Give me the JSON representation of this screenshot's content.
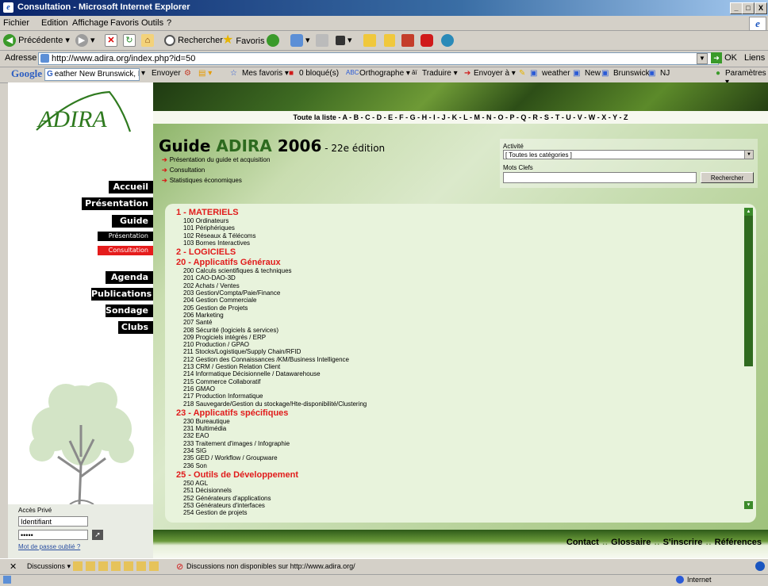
{
  "window": {
    "title": "Consultation - Microsoft Internet Explorer",
    "controls": {
      "minimize": "_",
      "maximize": "□",
      "close": "X"
    }
  },
  "menu": [
    "Fichier",
    "Edition",
    "Affichage",
    "Favoris",
    "Outils",
    "?"
  ],
  "toolbar": {
    "back": "Précédente",
    "search": "Rechercher",
    "favorites": "Favoris"
  },
  "address": {
    "label": "Adresse",
    "url": "http://www.adira.org/index.php?id=50",
    "go": "OK",
    "links": "Liens"
  },
  "google_bar": {
    "logo": "Google",
    "search_value": "eather New Brunswick, NJ",
    "items": [
      "Envoyer",
      "Mes favoris ▾",
      "0 bloqué(s)",
      "Orthographe ▾",
      "Traduire ▾",
      "Envoyer à ▾",
      "weather",
      "New",
      "Brunswick",
      "NJ"
    ],
    "settings": "Paramètres ▾"
  },
  "site": {
    "logo_text": "ADIRA",
    "nav": [
      {
        "label": "Accueil",
        "size": "big",
        "active": false
      },
      {
        "label": "Présentation",
        "size": "big",
        "active": false
      },
      {
        "label": "Guide",
        "size": "big",
        "active": false
      },
      {
        "label": "Présentation",
        "size": "small",
        "active": false
      },
      {
        "label": "Consultation",
        "size": "small",
        "active": true
      },
      {
        "label": "Agenda",
        "size": "big",
        "active": false
      },
      {
        "label": "Publications",
        "size": "big",
        "active": false
      },
      {
        "label": "Sondage",
        "size": "big",
        "active": false
      },
      {
        "label": "Clubs",
        "size": "big",
        "active": false
      }
    ],
    "login": {
      "title": "Accès Privé",
      "identifier": "Identifiant",
      "password": "•••••",
      "forgot": "Mot de passe oublié ?"
    },
    "az_bar": "Toute la liste - A - B - C - D - E - F - G - H - I - J - K - L - M - N - O - P - Q - R - S - T - U - V - W - X - Y - Z",
    "guide": {
      "title_prefix": "Guide ",
      "title_green": "ADIRA",
      "title_year": " 2006",
      "edition": " - 22e édition",
      "links": [
        "Présentation du guide et acquisition",
        "Consultation",
        "Statistiques économiques"
      ]
    },
    "search": {
      "activity_label": "Activité",
      "activity_value": "[ Toutes les catégories ]",
      "keywords_label": "Mots Clefs",
      "keywords_value": "",
      "button": "Rechercher"
    },
    "categories": [
      {
        "title": "1 - MATERIELS",
        "items": [
          "100 Ordinateurs",
          "101 Périphériques",
          "102 Réseaux & Télécoms",
          "103 Bornes Interactives"
        ]
      },
      {
        "title": "2 - LOGICIELS",
        "items": []
      },
      {
        "title": "20 - Applicatifs Généraux",
        "items": [
          "200 Calculs scientifiques & techniques",
          "201 CAO-DAO-3D",
          "202 Achats / Ventes",
          "203 Gestion/Compta/Paie/Finance",
          "204 Gestion Commerciale",
          "205 Gestion de Projets",
          "206 Marketing",
          "207 Santé",
          "208 Sécurité (logiciels & services)",
          "209 Progiciels intégrés / ERP",
          "210 Production / GPAO",
          "211 Stocks/Logistique/Supply Chain/RFID",
          "212 Gestion des Connaissances /KM/Business Intelligence",
          "213 CRM / Gestion Relation Client",
          "214 Informatique Décisionnelle / Datawarehouse",
          "215 Commerce Collaboratif",
          "216 GMAO",
          "217 Production Informatique",
          "218 Sauvegarde/Gestion du stockage/Hte-disponibilité/Clustering"
        ]
      },
      {
        "title": "23 - Applicatifs spécifiques",
        "items": [
          "230 Bureautique",
          "231 Multimédia",
          "232 EAO",
          "233 Traitement d'images / Infographie",
          "234 SIG",
          "235 GED / Workflow / Groupware",
          "236 Son"
        ]
      },
      {
        "title": "25 - Outils de Développement",
        "items": [
          "250 AGL",
          "251 Décisionnels",
          "252 Générateurs d'applications",
          "253 Générateurs d'interfaces",
          "254 Gestion de projets"
        ]
      }
    ],
    "footer_links": [
      "Contact",
      "Glossaire",
      "S'inscrire",
      "Références"
    ]
  },
  "links_bar": {
    "discussions": "Discussions ▾",
    "message": "Discussions non disponibles sur http://www.adira.org/"
  },
  "status": {
    "zone": "Internet"
  },
  "colors": {
    "accent_red": "#e11b1b",
    "green": "#2d6a1f",
    "title_blue": "#0a246a"
  }
}
